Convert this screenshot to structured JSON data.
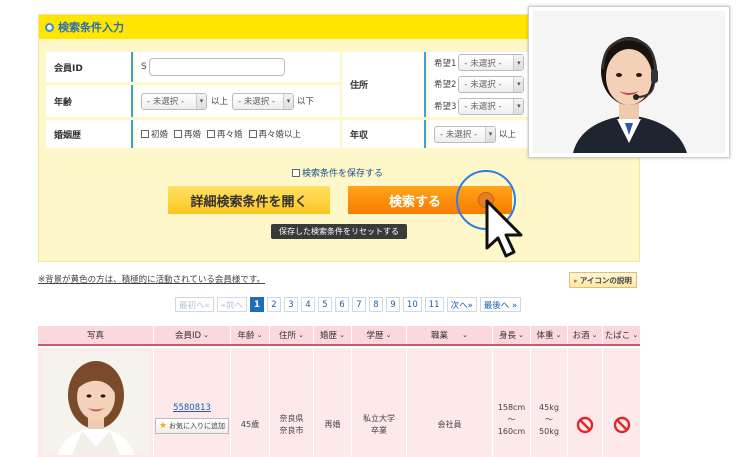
{
  "panel": {
    "title": "検索条件入力"
  },
  "form": {
    "member_id": {
      "label": "会員ID",
      "value": "S"
    },
    "age": {
      "label": "年齢",
      "from": "- 未選択 -",
      "from_suffix": "以上",
      "to": "- 未選択 -",
      "to_suffix": "以下"
    },
    "marriage": {
      "label": "婚姻歴",
      "options": [
        "初婚",
        "再婚",
        "再々婚",
        "再々婚以上"
      ]
    },
    "address": {
      "label": "住所",
      "wishes": [
        {
          "label": "希望1",
          "value": "- 未選択 -"
        },
        {
          "label": "希望2",
          "value": "- 未選択 -"
        },
        {
          "label": "希望3",
          "value": "- 未選択 -"
        }
      ]
    },
    "income": {
      "label": "年収",
      "from": "- 未選択 -",
      "from_suffix": "以上"
    },
    "save_label": "検索条件を保存する",
    "detail_button": "詳細検索条件を開く",
    "search_button": "検索する",
    "reset_button": "保存した検索条件をリセットする"
  },
  "note": "※背景が黄色の方は、積極的に活動されている会員様です。",
  "icon_help_button": "アイコンの説明",
  "pagination": {
    "first": "最初へ«",
    "prev": "«前へ",
    "pages": [
      "1",
      "2",
      "3",
      "4",
      "5",
      "6",
      "7",
      "8",
      "9",
      "10",
      "11"
    ],
    "current": "1",
    "next": "次へ»",
    "last": "最後へ »"
  },
  "table": {
    "headers": [
      "写真",
      "会員ID",
      "年齢",
      "住所",
      "婚歴",
      "学歴",
      "職業",
      "身長",
      "体重",
      "お酒",
      "たばこ"
    ],
    "sortable": [
      false,
      true,
      true,
      true,
      true,
      true,
      true,
      true,
      true,
      true,
      true
    ],
    "row": {
      "member_id": "5580813",
      "fav_label": "お気に入りに追加",
      "age": "45歳",
      "address_pref": "奈良県",
      "address_city": "奈良市",
      "marriage": "再婚",
      "education_1": "私立大学",
      "education_2": "卒業",
      "job": "会社員",
      "height_from": "158cm",
      "height_sep": "～",
      "height_to": "160cm",
      "weight_from": "45kg",
      "weight_sep": "～",
      "weight_to": "50kg"
    }
  },
  "colors": {
    "accent": "#ffe600",
    "search": "#f77b00",
    "link": "#1a5fb0",
    "ban": "#e0262b"
  }
}
